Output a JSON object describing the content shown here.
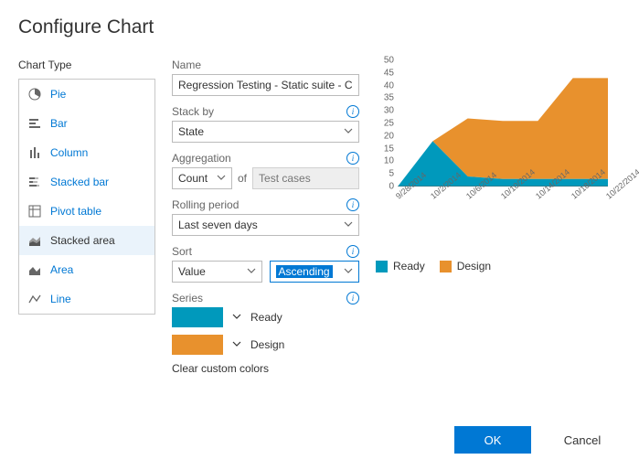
{
  "title": "Configure Chart",
  "sidebar": {
    "heading": "Chart Type",
    "items": [
      {
        "label": "Pie"
      },
      {
        "label": "Bar"
      },
      {
        "label": "Column"
      },
      {
        "label": "Stacked bar"
      },
      {
        "label": "Pivot table"
      },
      {
        "label": "Stacked area",
        "selected": true
      },
      {
        "label": "Area"
      },
      {
        "label": "Line"
      }
    ]
  },
  "form": {
    "name_label": "Name",
    "name_value": "Regression Testing - Static suite - Ch",
    "stackby_label": "Stack by",
    "stackby_value": "State",
    "aggregation_label": "Aggregation",
    "aggregation_value": "Count",
    "aggregation_of": "of",
    "aggregation_field": "Test cases",
    "rolling_label": "Rolling period",
    "rolling_value": "Last seven days",
    "sort_label": "Sort",
    "sort_by": "Value",
    "sort_dir": "Ascending",
    "series_label": "Series",
    "series": [
      {
        "name": "Ready",
        "color": "#0099bc"
      },
      {
        "name": "Design",
        "color": "#e8912d"
      }
    ],
    "clear_colors": "Clear custom colors"
  },
  "chart_data": {
    "type": "area",
    "title": "",
    "xlabel": "",
    "ylabel": "",
    "ylim": [
      0,
      50
    ],
    "yticks": [
      0,
      5,
      10,
      15,
      20,
      25,
      30,
      35,
      40,
      45,
      50
    ],
    "x": [
      "9/28/2014",
      "10/2/2014",
      "10/6/2014",
      "10/10/2014",
      "10/14/2014",
      "10/18/2014",
      "10/22/2014"
    ],
    "series": [
      {
        "name": "Ready",
        "color": "#0099bc",
        "values": [
          0,
          18,
          4,
          3,
          3,
          3,
          3
        ]
      },
      {
        "name": "Design",
        "color": "#e8912d",
        "values": [
          0,
          0,
          23,
          23,
          23,
          40,
          40
        ]
      }
    ],
    "legend": [
      "Ready",
      "Design"
    ],
    "legend_position": "bottom"
  },
  "footer": {
    "ok": "OK",
    "cancel": "Cancel"
  }
}
